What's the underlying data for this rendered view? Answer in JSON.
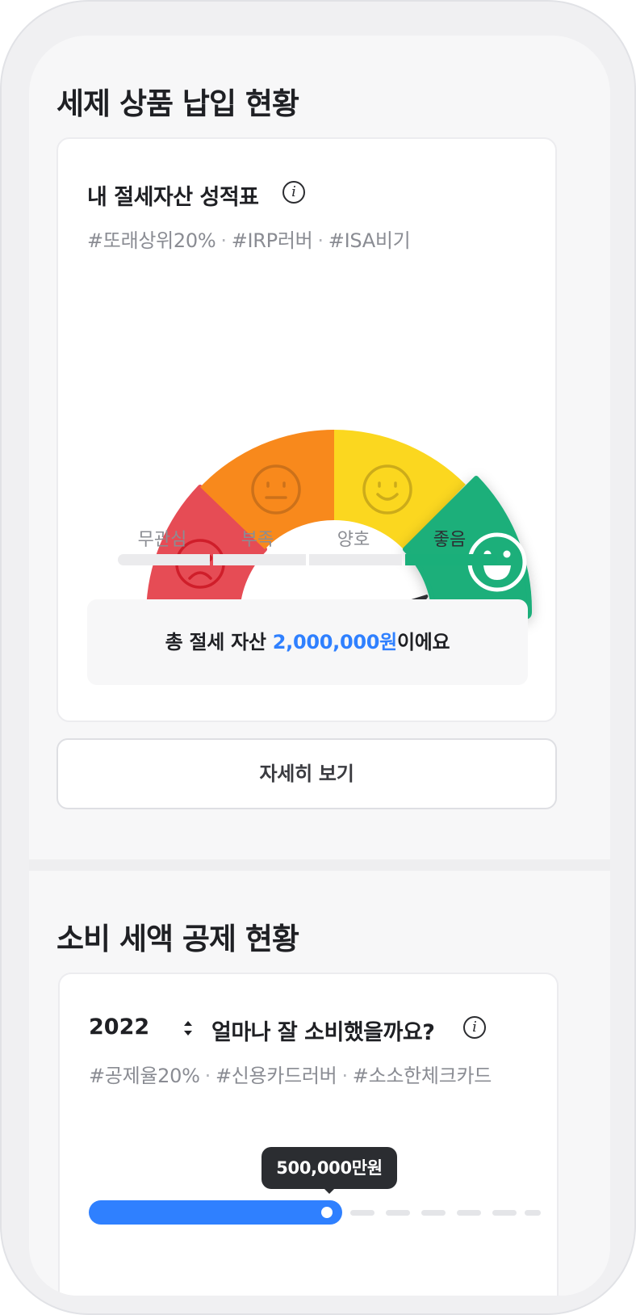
{
  "section1": {
    "title": "세제 상품 납입 현황",
    "card": {
      "title": "내 절세자산 성적표",
      "info_icon": "info-icon",
      "tags": [
        "#또래상위20%",
        "#IRP러버",
        "#ISA비기"
      ],
      "levels": [
        "무관심",
        "부족",
        "양호",
        "좋음"
      ],
      "active_level": "좋음",
      "colors": {
        "level1": "#e64c55",
        "level2": "#f8891c",
        "level3": "#fbd71f",
        "level4": "#1aaf7a",
        "active_bar": "#1aaf7a"
      },
      "faces": [
        "sad-face-icon",
        "neutral-face-icon",
        "smile-face-icon",
        "laughing-face-icon"
      ],
      "total_prefix": "총 절세 자산 ",
      "total_amount": "2,000,000원",
      "total_suffix": "이에요"
    },
    "detail_button": "자세히 보기"
  },
  "section2": {
    "title": "소비 세액 공제 현황",
    "card": {
      "year": "2022",
      "title": "얼마나 잘 소비했을까요?",
      "info_icon": "info-icon",
      "tags": [
        "#공제율20%",
        "#신용카드러버",
        "#소소한체크카드"
      ],
      "tooltip": "500,000만원",
      "progress_color": "#2f80ff"
    }
  }
}
